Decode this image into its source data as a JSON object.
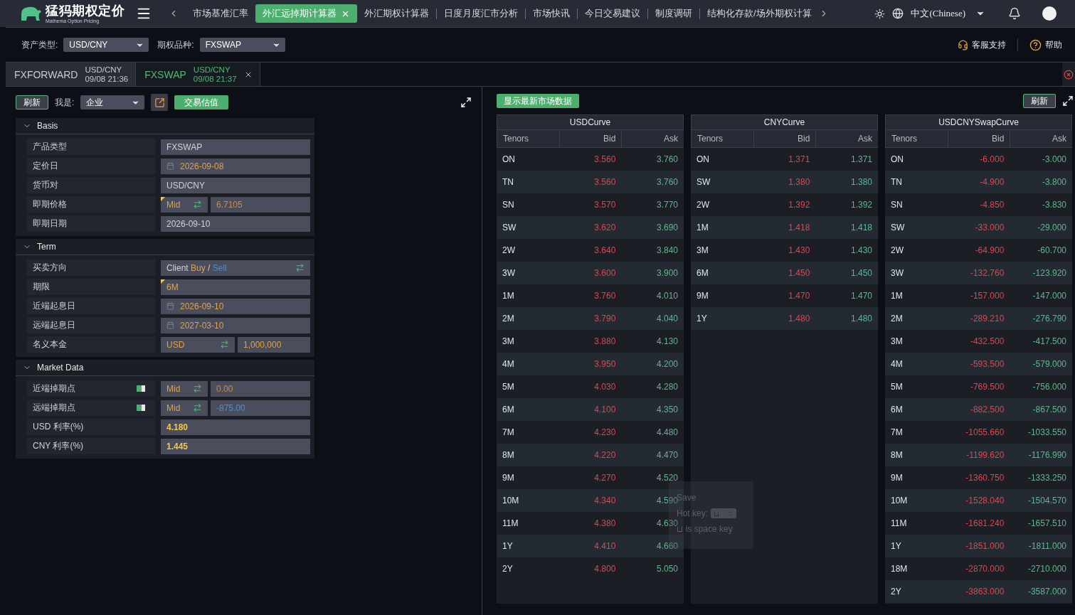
{
  "brand": {
    "name": "猛犸期权定价",
    "tagline": "Mathema Option Pricing"
  },
  "nav_tabs": [
    {
      "label": "市场基准汇率",
      "selected": false
    },
    {
      "label": "外汇远掉期计算器",
      "selected": true
    },
    {
      "label": "外汇期权计算器",
      "selected": false
    },
    {
      "label": "日度月度汇市分析",
      "selected": false
    },
    {
      "label": "市场快讯",
      "selected": false
    },
    {
      "label": "今日交易建议",
      "selected": false
    },
    {
      "label": "制度调研",
      "selected": false
    },
    {
      "label": "结构化存款/场外期权计算",
      "selected": false
    }
  ],
  "language": "中文(Chinese)",
  "toolbar": {
    "asset_label": "资产类型:",
    "asset_value": "USD/CNY",
    "product_label": "期权品种:",
    "product_value": "FXSWAP",
    "support": "客服支持",
    "help": "帮助"
  },
  "doc_tabs": [
    {
      "name": "FXFORWARD",
      "pair": "USD/CNY",
      "time": "09/08 21:36",
      "selected": false
    },
    {
      "name": "FXSWAP",
      "pair": "USD/CNY",
      "time": "09/08 21:37",
      "selected": true
    }
  ],
  "left_panel": {
    "refresh": "刷新",
    "role_label": "我是:",
    "role_value": "企业",
    "valuate": "交易估值",
    "sections": [
      {
        "title": "Basis",
        "expanded": true,
        "rows": [
          {
            "kind": "text",
            "label": "产品类型",
            "value": "FXSWAP",
            "flagged": false
          },
          {
            "kind": "date",
            "label": "定价日",
            "value": "2026-09-08",
            "flagged": false
          },
          {
            "kind": "text",
            "label": "货币对",
            "value": "USD/CNY",
            "flagged": false
          },
          {
            "kind": "quote",
            "label": "即期价格",
            "side": "Mid",
            "value": "6.7105",
            "color": "#d08a4a",
            "flagged": true
          },
          {
            "kind": "text",
            "label": "即期日期",
            "value": "2026-09-10",
            "flagged": false
          }
        ]
      },
      {
        "title": "Term",
        "expanded": true,
        "rows": [
          {
            "kind": "direction",
            "label": "买卖方向",
            "prefix": "Client",
            "buy": "Buy",
            "sep": "/",
            "sell": "Sell",
            "flagged": false
          },
          {
            "kind": "tenor",
            "label": "期限",
            "value": "6M",
            "flagged": true
          },
          {
            "kind": "date",
            "label": "近端起息日",
            "value": "2026-09-10",
            "flagged": false
          },
          {
            "kind": "date",
            "label": "远端起息日",
            "value": "2027-03-10",
            "flagged": false
          },
          {
            "kind": "notional",
            "label": "名义本金",
            "currency": "USD",
            "value": "1,000,000",
            "flagged": false
          }
        ]
      },
      {
        "title": "Market Data",
        "expanded": true,
        "rows": [
          {
            "kind": "points",
            "label": "近端掉期点",
            "side": "Mid",
            "value": "0.00",
            "color": "#d08a4a",
            "flagged": false
          },
          {
            "kind": "points",
            "label": "远端掉期点",
            "side": "Mid",
            "value": "-875.00",
            "color": "#4a8fd8",
            "flagged": false
          },
          {
            "kind": "rate",
            "label": "USD 利率(%)",
            "value": "4.180",
            "flagged": false
          },
          {
            "kind": "rate",
            "label": "CNY 利率(%)",
            "value": "1.445",
            "flagged": false
          }
        ]
      }
    ]
  },
  "right_panel": {
    "show_latest": "显示最新市场数据",
    "refresh": "刷新",
    "curves": [
      {
        "title": "USDCurve",
        "columns": [
          "Tenors",
          "Bid",
          "Ask"
        ],
        "rows": [
          [
            "ON",
            "3.560",
            "3.760"
          ],
          [
            "TN",
            "3.560",
            "3.760"
          ],
          [
            "SN",
            "3.570",
            "3.770"
          ],
          [
            "SW",
            "3.620",
            "3.690"
          ],
          [
            "2W",
            "3.640",
            "3.840"
          ],
          [
            "3W",
            "3.600",
            "3.900"
          ],
          [
            "1M",
            "3.760",
            "4.010"
          ],
          [
            "2M",
            "3.790",
            "4.040"
          ],
          [
            "3M",
            "3.880",
            "4.130"
          ],
          [
            "4M",
            "3.950",
            "4.200"
          ],
          [
            "5M",
            "4.030",
            "4.280"
          ],
          [
            "6M",
            "4.100",
            "4.350"
          ],
          [
            "7M",
            "4.230",
            "4.480"
          ],
          [
            "8M",
            "4.220",
            "4.470"
          ],
          [
            "9M",
            "4.270",
            "4.520"
          ],
          [
            "10M",
            "4.340",
            "4.590"
          ],
          [
            "11M",
            "4.380",
            "4.630"
          ],
          [
            "1Y",
            "4.410",
            "4.660"
          ],
          [
            "2Y",
            "4.800",
            "5.050"
          ]
        ]
      },
      {
        "title": "CNYCurve",
        "columns": [
          "Tenors",
          "Bid",
          "Ask"
        ],
        "rows": [
          [
            "ON",
            "1.371",
            "1.371"
          ],
          [
            "SW",
            "1.380",
            "1.380"
          ],
          [
            "2W",
            "1.392",
            "1.392"
          ],
          [
            "1M",
            "1.418",
            "1.418"
          ],
          [
            "3M",
            "1.430",
            "1.430"
          ],
          [
            "6M",
            "1.450",
            "1.450"
          ],
          [
            "9M",
            "1.470",
            "1.470"
          ],
          [
            "1Y",
            "1.480",
            "1.480"
          ]
        ]
      },
      {
        "title": "USDCNYSwapCurve",
        "columns": [
          "Tenors",
          "Bid",
          "Ask"
        ],
        "rows": [
          [
            "ON",
            "-6.000",
            "-3.000"
          ],
          [
            "TN",
            "-4.900",
            "-3.800"
          ],
          [
            "SN",
            "-4.850",
            "-3.830"
          ],
          [
            "SW",
            "-33.000",
            "-29.000"
          ],
          [
            "2W",
            "-64.900",
            "-60.700"
          ],
          [
            "3W",
            "-132.760",
            "-123.920"
          ],
          [
            "1M",
            "-157.000",
            "-147.000"
          ],
          [
            "2M",
            "-289.210",
            "-276.790"
          ],
          [
            "3M",
            "-432.500",
            "-417.500"
          ],
          [
            "4M",
            "-593.500",
            "-579.000"
          ],
          [
            "5M",
            "-769.500",
            "-756.000"
          ],
          [
            "6M",
            "-882.500",
            "-867.500"
          ],
          [
            "7M",
            "-1055.660",
            "-1033.550"
          ],
          [
            "8M",
            "-1199.620",
            "-1176.990"
          ],
          [
            "9M",
            "-1360.750",
            "-1333.250"
          ],
          [
            "10M",
            "-1528.040",
            "-1504.570"
          ],
          [
            "11M",
            "-1681.240",
            "-1657.510"
          ],
          [
            "1Y",
            "-1851.000",
            "-1811.000"
          ],
          [
            "18M",
            "-2870.000",
            "-2710.000"
          ],
          [
            "2Y",
            "-3863.000",
            "-3587.000"
          ]
        ]
      }
    ]
  },
  "hotkey_popup": {
    "title": "Save",
    "label": "Hot key:",
    "key": "⊔",
    "note": "⊔ is space key"
  }
}
